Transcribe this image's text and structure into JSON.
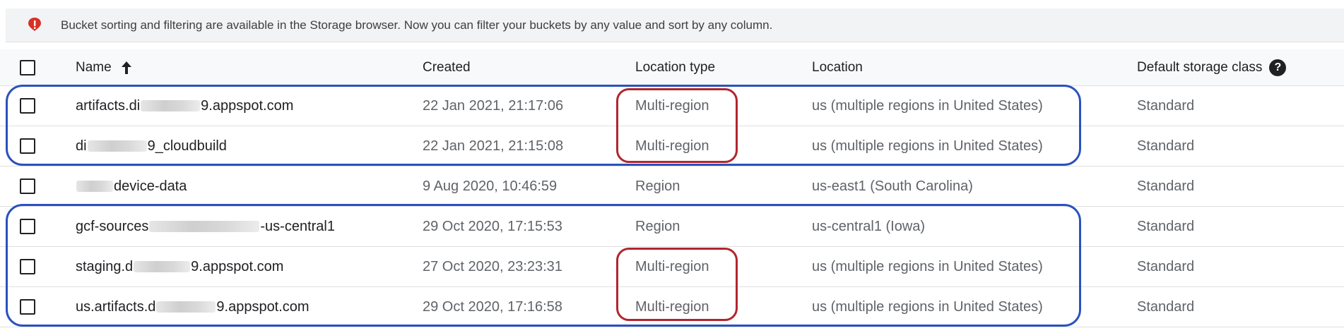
{
  "banner": {
    "icon": "alert-icon",
    "icon_color": "#d93025",
    "text": "Bucket sorting and filtering are available in the Storage browser. Now you can filter your buckets by any value and sort by any column."
  },
  "table": {
    "headers": {
      "name": "Name",
      "created": "Created",
      "location_type": "Location type",
      "location": "Location",
      "storage_class": "Default storage class"
    },
    "sort": {
      "column": "name",
      "direction": "ascending",
      "icon": "arrow-up-icon"
    },
    "help_icon": "help-icon",
    "rows": [
      {
        "name_prefix": "artifacts.di",
        "name_suffix": "9.appspot.com",
        "created": "22 Jan 2021, 21:17:06",
        "location_type": "Multi-region",
        "location": "us (multiple regions in United States)",
        "storage_class": "Standard"
      },
      {
        "name_prefix": "di",
        "name_suffix": "9_cloudbuild",
        "created": "22 Jan 2021, 21:15:08",
        "location_type": "Multi-region",
        "location": "us (multiple regions in United States)",
        "storage_class": "Standard"
      },
      {
        "name_prefix": "",
        "name_suffix": "device-data",
        "created": "9 Aug 2020, 10:46:59",
        "location_type": "Region",
        "location": "us-east1 (South Carolina)",
        "storage_class": "Standard"
      },
      {
        "name_prefix": "gcf-sources",
        "name_suffix": "-us-central1",
        "created": "29 Oct 2020, 17:15:53",
        "location_type": "Region",
        "location": "us-central1 (Iowa)",
        "storage_class": "Standard"
      },
      {
        "name_prefix": "staging.d",
        "name_suffix": "9.appspot.com",
        "created": "27 Oct 2020, 23:23:31",
        "location_type": "Multi-region",
        "location": "us (multiple regions in United States)",
        "storage_class": "Standard"
      },
      {
        "name_prefix": "us.artifacts.d",
        "name_suffix": "9.appspot.com",
        "created": "29 Oct 2020, 17:16:58",
        "location_type": "Multi-region",
        "location": "us (multiple regions in United States)",
        "storage_class": "Standard"
      }
    ]
  },
  "annotations": {
    "blue_color": "#2a52be",
    "red_color": "#b0262e"
  }
}
